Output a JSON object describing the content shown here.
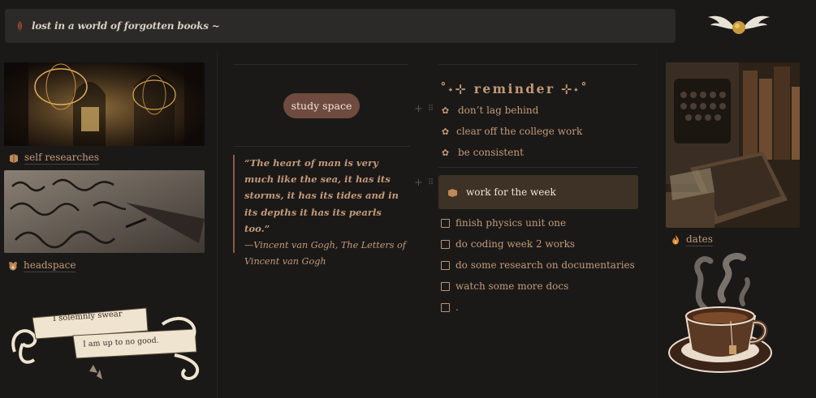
{
  "banner": {
    "text": "lost in a world of forgotten books ~",
    "icon": "leaf-icon"
  },
  "left": {
    "card1": {
      "caption": "self researches",
      "icon": "book-icon"
    },
    "card2": {
      "caption": "headspace",
      "icon": "teddy-bear-icon"
    },
    "ribbon": {
      "line1": "I solemnly swear",
      "line2": "I am up to no good."
    }
  },
  "middle": {
    "button": "study space",
    "quote": {
      "text": "“The heart of man is very much like the sea, it has its storms, it has its tides and in its depths it has its pearls too.”",
      "attribution": "—Vincent van Gogh, The Letters of Vincent van Gogh"
    }
  },
  "right": {
    "reminder_title": "˚˖⊹ reminder ⊹˖˚",
    "reminders": [
      "don’t lag behind",
      "clear off the college work",
      "be consistent"
    ],
    "callout": "work for the week",
    "todos": [
      "finish physics unit one",
      "do coding week 2 works",
      "do some research on documentaries",
      "watch some more docs",
      "."
    ]
  },
  "far_right": {
    "caption": "dates",
    "icon": "flame-icon"
  },
  "colors": {
    "bg": "#1a1918",
    "accent": "#c49a78",
    "pill": "#6e4b3e",
    "callout": "#3d3225"
  }
}
